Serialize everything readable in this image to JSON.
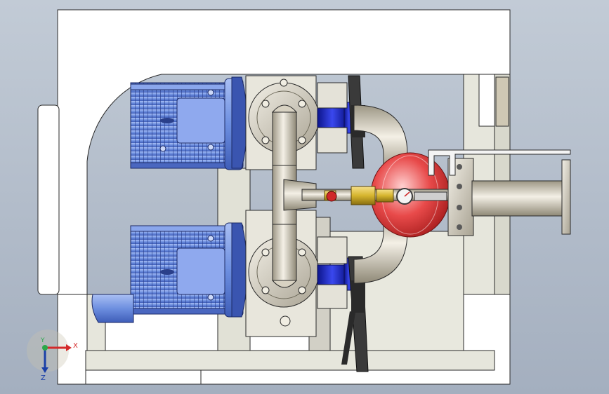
{
  "viewport": {
    "model": "booster-pump-skid",
    "background_top": "#c2cbd6",
    "background_bottom": "#a4afbf"
  },
  "colors": {
    "frame": "#ffffff",
    "frame_edge": "#2a2a2a",
    "motor_blue": "#6d8fe0",
    "motor_shade": "#3e5db8",
    "valve_blue": "#1826c8",
    "pipe_steel": "#d8d2c2",
    "tank_red": "#e03838",
    "brass": "#d6b52e",
    "handle_dark": "#2a2a2a"
  },
  "triad": {
    "x_label": "X",
    "y_label": "Y",
    "z_label": "Z",
    "x_color": "#d42a2a",
    "y_color": "#2aa84a",
    "z_color": "#1a3fa8"
  }
}
